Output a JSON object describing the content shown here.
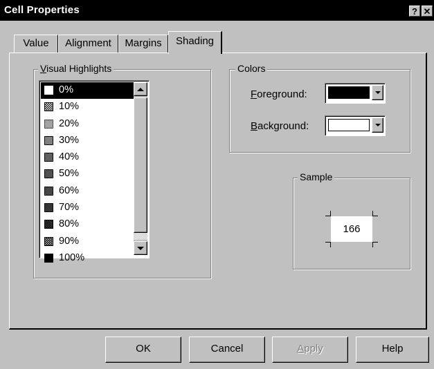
{
  "window": {
    "title": "Cell Properties",
    "help_button": "?",
    "close_button": "✕"
  },
  "tabs": [
    {
      "label": "Value"
    },
    {
      "label": "Alignment"
    },
    {
      "label": "Margins"
    },
    {
      "label": "Shading",
      "active": true
    }
  ],
  "visual_highlights": {
    "legend_prefix": "V",
    "legend_rest": "isual Highlights",
    "items": [
      "0%",
      "10%",
      "20%",
      "30%",
      "40%",
      "50%",
      "60%",
      "70%",
      "80%",
      "90%",
      "100%"
    ],
    "selected": "0%"
  },
  "colors": {
    "legend": "Colors",
    "foreground": {
      "label_prefix": "F",
      "label_rest": "oreground:",
      "value": "#000000"
    },
    "background": {
      "label_prefix": "B",
      "label_rest": "ackground:",
      "value": "#ffffff"
    }
  },
  "sample": {
    "legend": "Sample",
    "value": "166"
  },
  "buttons": {
    "ok": "OK",
    "cancel": "Cancel",
    "apply_prefix": "A",
    "apply_rest": "pply",
    "help": "Help"
  },
  "palette": {
    "face": "#c0c0c0",
    "title_bar": "#000000"
  }
}
